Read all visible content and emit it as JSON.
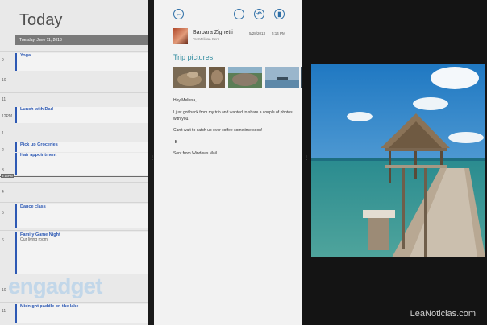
{
  "calendar": {
    "title": "Today",
    "date": "Tuesday, June 11, 2013",
    "hours": [
      "9",
      "10",
      "11",
      "12PM",
      "1",
      "2",
      "3",
      "4",
      "5",
      "6",
      "7",
      "10",
      "11"
    ],
    "now_label": "3:15PM",
    "events": [
      {
        "title": "Yoga",
        "sub": ""
      },
      {
        "title": "Lunch with Dad",
        "sub": ""
      },
      {
        "title": "Pick up Groceries",
        "sub": ""
      },
      {
        "title": "Hair appointment",
        "sub": ""
      },
      {
        "title": "Dance class",
        "sub": ""
      },
      {
        "title": "Family Game Night",
        "sub": "Our living room"
      },
      {
        "title": "Midnight paddle on the lake",
        "sub": ""
      }
    ]
  },
  "mail": {
    "sender": "Barbara Zighetti",
    "recipient": "To: Melissa Kern",
    "date": "5/28/2013",
    "time": "5:14 PM",
    "subject": "Trip pictures",
    "body": [
      "Hey Melissa,",
      "I just got back from my trip and wanted to share a couple of photos with you.",
      "Can't wait to catch up over coffee sometime soon!",
      "-B",
      "Sent from Windows Mail"
    ],
    "toolbar_icons": [
      "back-arrow-icon",
      "add-icon",
      "reply-icon",
      "delete-icon"
    ]
  },
  "watermark": "engadget",
  "site_credit": "LeaNoticias.com",
  "colors": {
    "accent": "#2d59b4",
    "subject": "#2d8a9e",
    "button": "#2d6ea6"
  }
}
